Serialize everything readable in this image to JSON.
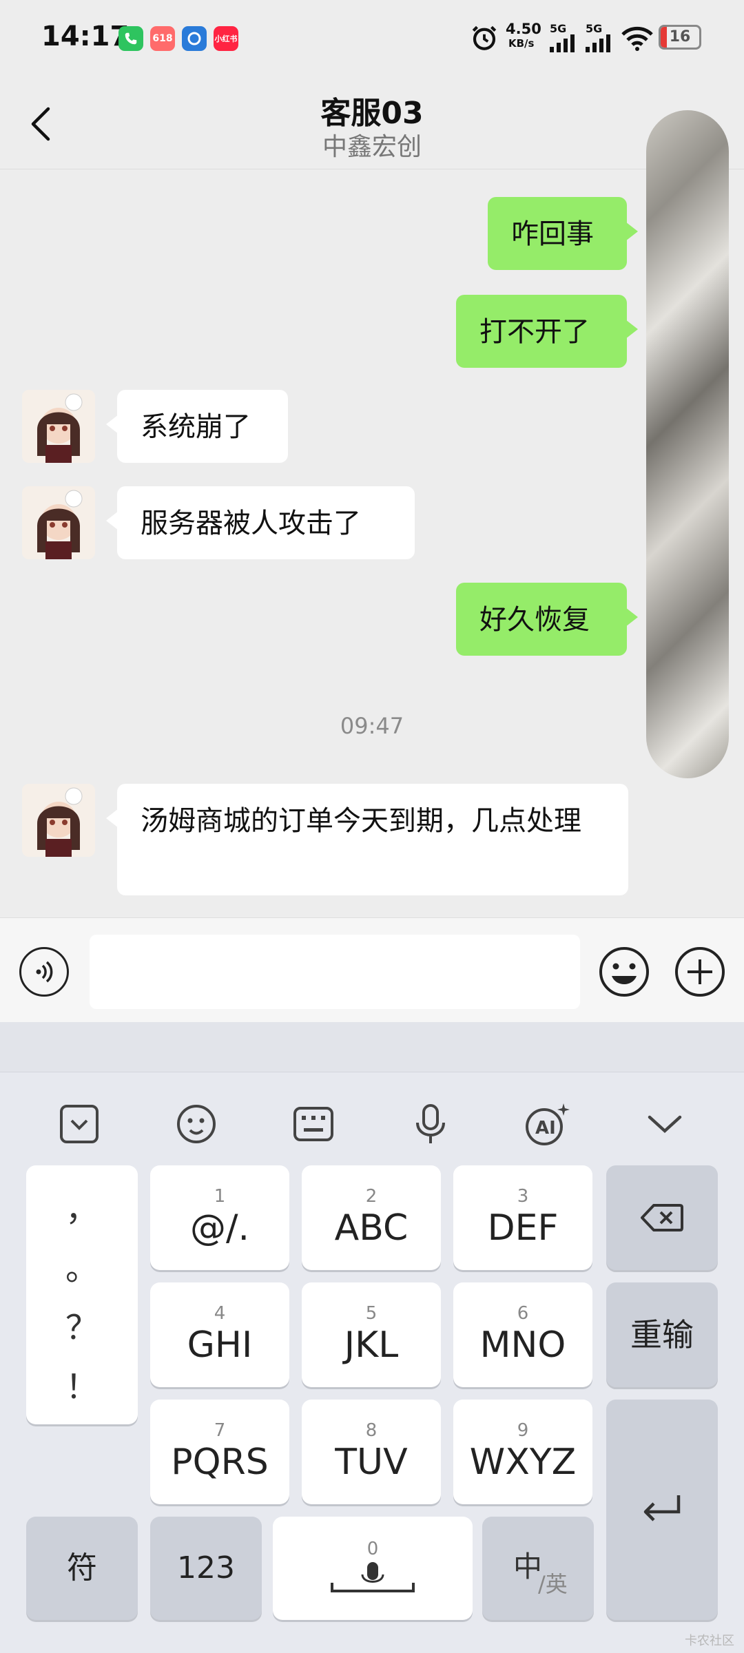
{
  "status_bar": {
    "time": "14:17",
    "apps": [
      {
        "icon": "phone-app-icon",
        "label": "",
        "color": "#2ec45f"
      },
      {
        "icon": "618-app-icon",
        "label": "618",
        "color": "#ff6b6b"
      },
      {
        "icon": "browser-app-icon",
        "label": "",
        "color": "#2a7bd9"
      },
      {
        "icon": "xiaohongshu-app-icon",
        "label": "小红书",
        "color": "#ff2442"
      }
    ],
    "net_speed": "4.50",
    "net_unit": "KB/s",
    "sim1": "5G",
    "sim2": "5G",
    "battery": "16",
    "battery_level": 0.16
  },
  "header": {
    "title": "客服03",
    "subtitle": "中鑫宏创"
  },
  "messages": [
    {
      "side": "out",
      "text": "咋回事"
    },
    {
      "side": "out",
      "text": "打不开了"
    },
    {
      "side": "in",
      "text": "系统崩了"
    },
    {
      "side": "in",
      "text": "服务器被人攻击了"
    },
    {
      "side": "out",
      "text": "好久恢复"
    },
    {
      "side": "in",
      "text": "汤姆商城的订单今天到期，几点处理"
    }
  ],
  "timestamp": "09:47",
  "input_bar": {
    "placeholder": ""
  },
  "keyboard": {
    "punctuation": [
      "，",
      "。",
      "？",
      "！"
    ],
    "keys": [
      {
        "sub": "1",
        "main": "@/."
      },
      {
        "sub": "2",
        "main": "ABC"
      },
      {
        "sub": "3",
        "main": "DEF"
      },
      {
        "sub": "4",
        "main": "GHI"
      },
      {
        "sub": "5",
        "main": "JKL"
      },
      {
        "sub": "6",
        "main": "MNO"
      },
      {
        "sub": "7",
        "main": "PQRS"
      },
      {
        "sub": "8",
        "main": "TUV"
      },
      {
        "sub": "9",
        "main": "WXYZ"
      }
    ],
    "reenter": "重输",
    "symbols": "符",
    "numbers": "123",
    "space_sub": "0",
    "lang_main": "中",
    "lang_sub": "/英"
  },
  "watermark": "卡农社区",
  "colors": {
    "sent_bubble": "#95ec69",
    "received_bubble": "#ffffff",
    "chat_background": "#ededed"
  }
}
